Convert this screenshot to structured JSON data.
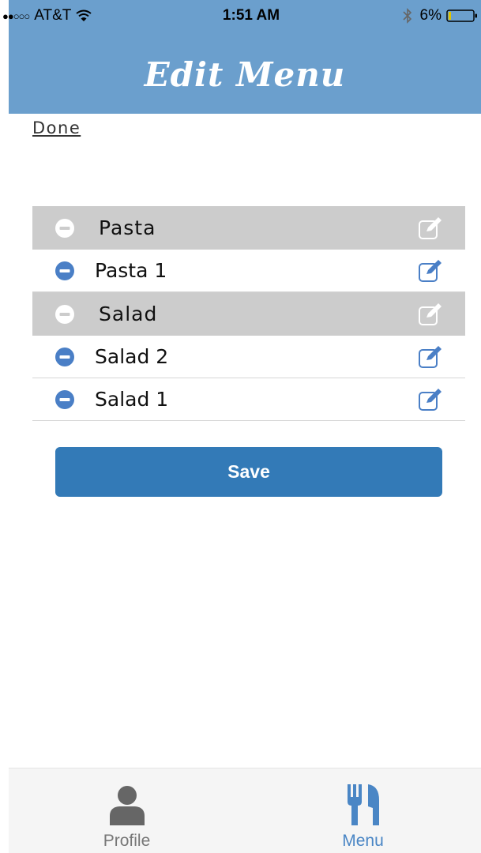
{
  "status_bar": {
    "signal": "●●○○○",
    "carrier": "AT&T",
    "time": "1:51 AM",
    "battery": "6%"
  },
  "header": {
    "title": "Edit Menu"
  },
  "toolbar": {
    "done_label": "Done"
  },
  "menu": {
    "rows": [
      {
        "type": "category",
        "label": "Pasta"
      },
      {
        "type": "item",
        "label": "Pasta 1"
      },
      {
        "type": "category",
        "label": "Salad"
      },
      {
        "type": "item",
        "label": "Salad 2"
      },
      {
        "type": "item",
        "label": "Salad 1"
      }
    ]
  },
  "actions": {
    "save_label": "Save"
  },
  "tabs": [
    {
      "label": "Profile",
      "icon": "person-icon",
      "active": false
    },
    {
      "label": "Menu",
      "icon": "fork-knife-icon",
      "active": true
    }
  ],
  "colors": {
    "header": "#6b9fcd",
    "category_row": "#cccccc",
    "accent": "#4a86c5",
    "save_button": "#337ab7",
    "inactive_tab": "#777777"
  }
}
